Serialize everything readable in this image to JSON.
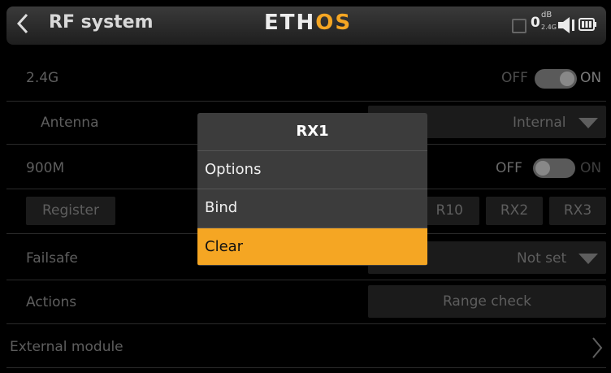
{
  "header": {
    "title": "RF system",
    "logo_main": "ETH",
    "logo_accent": "OS",
    "signal_value": "0",
    "signal_unit": "dB",
    "signal_band": "2.4G"
  },
  "rows": {
    "band24": {
      "label": "2.4G",
      "off": "OFF",
      "on": "ON"
    },
    "antenna": {
      "label": "Antenna",
      "value": "Internal"
    },
    "band900": {
      "label": "900M",
      "off": "OFF",
      "on": "ON"
    },
    "register": {
      "label": "Register",
      "rx_partial": "R10",
      "rx2": "RX2",
      "rx3": "RX3"
    },
    "failsafe": {
      "label": "Failsafe",
      "value": "Not set"
    },
    "actions": {
      "label": "Actions",
      "value": "Range check"
    },
    "external": {
      "label": "External module"
    }
  },
  "dialog": {
    "title": "RX1",
    "items": [
      {
        "label": "Options",
        "selected": false
      },
      {
        "label": "Bind",
        "selected": false
      },
      {
        "label": "Clear",
        "selected": true
      }
    ]
  },
  "colors": {
    "accent": "#f5a623",
    "background": "#000000",
    "dialog": "#3c3c3c"
  }
}
